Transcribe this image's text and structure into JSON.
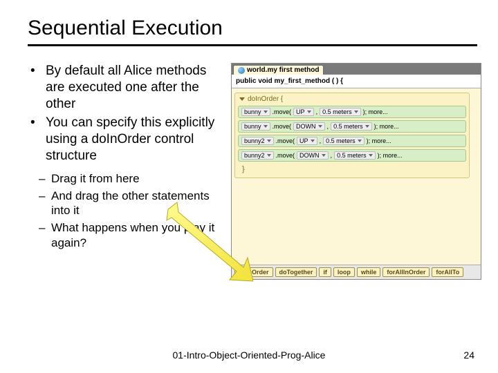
{
  "title": "Sequential Execution",
  "bullets": {
    "b1": "By default all Alice methods are executed one after the other",
    "b2": "You can specify this explicitly using a doInOrder control structure"
  },
  "sub": {
    "s1": "Drag it from here",
    "s2": "And drag the other statements into it",
    "s3": "What happens when you play it again?"
  },
  "alice": {
    "tab": "world.my first method",
    "signature": "public void my_first_method ( ) {",
    "doInOrder": "doInOrder {",
    "closeBrace": "}",
    "stmts": {
      "s0": {
        "obj": "bunny",
        "method": ".move(",
        "arg1": "UP",
        "arg2": "0.5 meters",
        "tail": "); more..."
      },
      "s1": {
        "obj": "bunny",
        "method": ".move(",
        "arg1": "DOWN",
        "arg2": "0.5 meters",
        "tail": "); more..."
      },
      "s2": {
        "obj": "bunny2",
        "method": ".move(",
        "arg1": "UP",
        "arg2": "0.5 meters",
        "tail": "); more..."
      },
      "s3": {
        "obj": "bunny2",
        "method": ".move(",
        "arg1": "DOWN",
        "arg2": "0.5 meters",
        "tail": "); more..."
      }
    }
  },
  "palette": {
    "p0": "doInOrder",
    "p1": "doTogether",
    "p2": "if",
    "p3": "loop",
    "p4": "while",
    "p5": "forAllInOrder",
    "p6": "forAllTo"
  },
  "footer": "01-Intro-Object-Oriented-Prog-Alice",
  "page": "24"
}
